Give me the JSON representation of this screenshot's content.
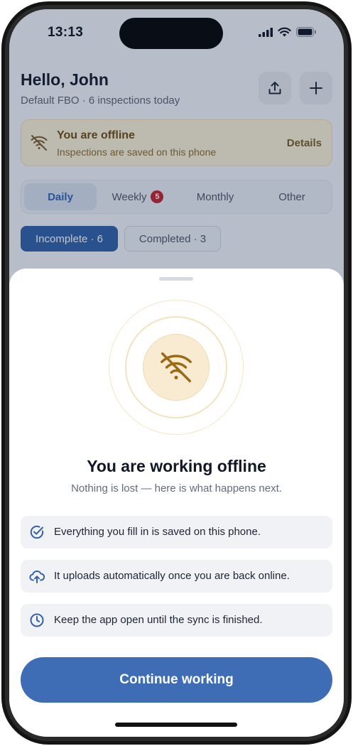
{
  "status_bar": {
    "time": "13:13"
  },
  "header": {
    "greeting": "Hello, John",
    "subtitle": "Default FBO · 6 inspections today",
    "upload_icon": "upload-icon",
    "add_icon": "plus-icon"
  },
  "offline_banner": {
    "icon": "wifi-off-icon",
    "title": "You are offline",
    "subtitle": "Inspections are saved on this phone",
    "details_label": "Details"
  },
  "tabs": [
    {
      "label": "Daily",
      "active": true
    },
    {
      "label": "Weekly",
      "badge": "5"
    },
    {
      "label": "Monthly"
    },
    {
      "label": "Other"
    }
  ],
  "filters": {
    "incomplete": "Incomplete · 6",
    "completed": "Completed · 3"
  },
  "sheet": {
    "hero_icon": "wifi-off-icon",
    "title": "You are working offline",
    "subtitle": "Nothing is lost — here is what happens next.",
    "items": [
      {
        "icon": "check-circle-icon",
        "text": "Everything you fill in is saved on this phone."
      },
      {
        "icon": "cloud-upload-icon",
        "text": "It uploads automatically once you are back online."
      },
      {
        "icon": "clock-icon",
        "text": "Keep the app open until the sync is finished."
      }
    ],
    "cta_label": "Continue working"
  },
  "colors": {
    "accent": "#3e6db5",
    "warning_bg": "#fbf0d6",
    "warning_text": "#6b4a0c",
    "badge": "#c0202a"
  }
}
